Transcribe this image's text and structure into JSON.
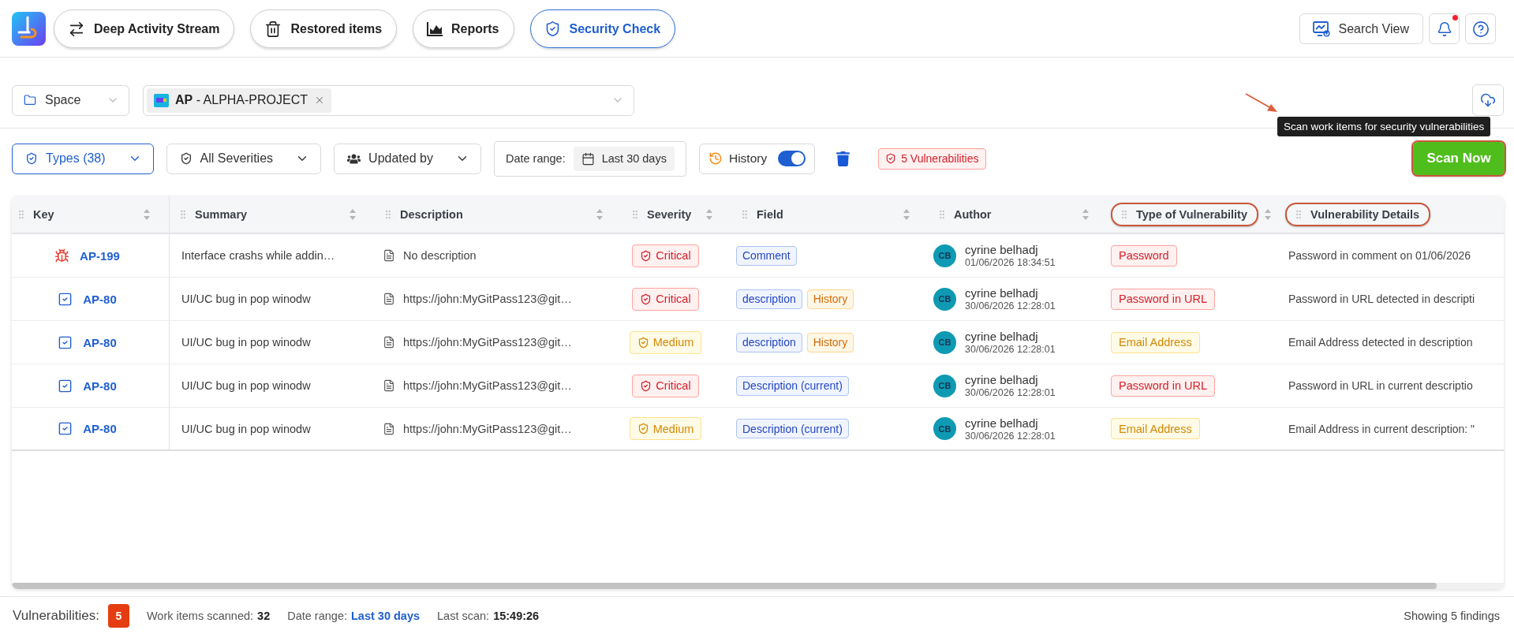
{
  "nav_tabs": [
    {
      "label": "Deep Activity Stream",
      "selected": false
    },
    {
      "label": "Restored items",
      "selected": false
    },
    {
      "label": "Reports",
      "selected": false
    },
    {
      "label": "Security Check",
      "selected": true
    }
  ],
  "header": {
    "search_view": "Search View",
    "notifications": {
      "unread": true
    }
  },
  "scope": {
    "space_select": "Space",
    "projects": [
      {
        "label": "**AP** - ALPHA-PROJECT"
      }
    ]
  },
  "tooltip": "Scan work items for security vulnerabilities",
  "filters": {
    "dropdowns": [
      {
        "label": "Types (38)",
        "active": true
      },
      {
        "label": "All Severities",
        "active": false
      },
      {
        "label": "Updated by",
        "active": false
      }
    ],
    "date_range": {
      "label": "Date range:",
      "value": "Last 30 days"
    },
    "history": {
      "label": "History",
      "on": true
    },
    "vulnerability_badge": "5 Vulnerabilities",
    "scan_button": {
      "label": "Scan Now",
      "highlighted": true
    }
  },
  "table": {
    "columns": [
      {
        "label": "Key",
        "sortable": true,
        "highlighted": false
      },
      {
        "label": "Summary",
        "sortable": true,
        "highlighted": false
      },
      {
        "label": "Description",
        "sortable": true,
        "highlighted": false
      },
      {
        "label": "Severity",
        "sortable": true,
        "highlighted": false
      },
      {
        "label": "Field",
        "sortable": true,
        "highlighted": false
      },
      {
        "label": "Author",
        "sortable": true,
        "highlighted": false
      },
      {
        "label": "Type of Vulnerability",
        "sortable": true,
        "highlighted": true
      },
      {
        "label": "Vulnerability Details",
        "sortable": false,
        "highlighted": true
      }
    ],
    "rows": [
      {
        "issue": {
          "key": "AP-199",
          "kind": "bug"
        },
        "summary": "Interface crashs while addin…",
        "description": "No description",
        "severity": {
          "label": "Critical",
          "kind": "critical"
        },
        "fields": [
          {
            "label": "Comment",
            "kind": "field"
          }
        ],
        "author": {
          "initials": "CB",
          "name": "cyrine belhadj",
          "time": "01/06/2026 18:34:51"
        },
        "vulnerability": {
          "label": "Password",
          "kind": "critical"
        },
        "details": "Password in comment on 01/06/2026"
      },
      {
        "issue": {
          "key": "AP-80",
          "kind": "task"
        },
        "summary": "UI/UC bug in pop winodw",
        "description": "https://john:MyGitPass123@git…",
        "severity": {
          "label": "Critical",
          "kind": "critical"
        },
        "fields": [
          {
            "label": "description",
            "kind": "field"
          },
          {
            "label": "History",
            "kind": "history"
          }
        ],
        "author": {
          "initials": "CB",
          "name": "cyrine belhadj",
          "time": "30/06/2026 12:28:01"
        },
        "vulnerability": {
          "label": "Password in URL",
          "kind": "critical"
        },
        "details": "Password in URL detected in descripti"
      },
      {
        "issue": {
          "key": "AP-80",
          "kind": "task"
        },
        "summary": "UI/UC bug in pop winodw",
        "description": "https://john:MyGitPass123@git…",
        "severity": {
          "label": "Medium",
          "kind": "medium"
        },
        "fields": [
          {
            "label": "description",
            "kind": "field"
          },
          {
            "label": "History",
            "kind": "history"
          }
        ],
        "author": {
          "initials": "CB",
          "name": "cyrine belhadj",
          "time": "30/06/2026 12:28:01"
        },
        "vulnerability": {
          "label": "Email Address",
          "kind": "medium"
        },
        "details": "Email Address detected in description"
      },
      {
        "issue": {
          "key": "AP-80",
          "kind": "task"
        },
        "summary": "UI/UC bug in pop winodw",
        "description": "https://john:MyGitPass123@git…",
        "severity": {
          "label": "Critical",
          "kind": "critical"
        },
        "fields": [
          {
            "label": "Description (current)",
            "kind": "field"
          }
        ],
        "author": {
          "initials": "CB",
          "name": "cyrine belhadj",
          "time": "30/06/2026 12:28:01"
        },
        "vulnerability": {
          "label": "Password in URL",
          "kind": "critical"
        },
        "details": "Password in URL in current descriptio"
      },
      {
        "issue": {
          "key": "AP-80",
          "kind": "task"
        },
        "summary": "UI/UC bug in pop winodw",
        "description": "https://john:MyGitPass123@git…",
        "severity": {
          "label": "Medium",
          "kind": "medium"
        },
        "fields": [
          {
            "label": "Description (current)",
            "kind": "field"
          }
        ],
        "author": {
          "initials": "CB",
          "name": "cyrine belhadj",
          "time": "30/06/2026 12:28:01"
        },
        "vulnerability": {
          "label": "Email Address",
          "kind": "medium"
        },
        "details": "Email Address in current description: \""
      }
    ]
  },
  "footer": {
    "vulnerabilities_label": "Vulnerabilities:",
    "vulnerabilities_count": "5",
    "stats": [
      {
        "label": "Work items scanned:",
        "value": "32",
        "kind": "bold"
      },
      {
        "label": "Date range:",
        "value": "Last 30 days",
        "kind": "link"
      },
      {
        "label": "Last scan:",
        "value": "15:49:26",
        "kind": "bold"
      }
    ],
    "showing": "Showing 5 findings"
  }
}
